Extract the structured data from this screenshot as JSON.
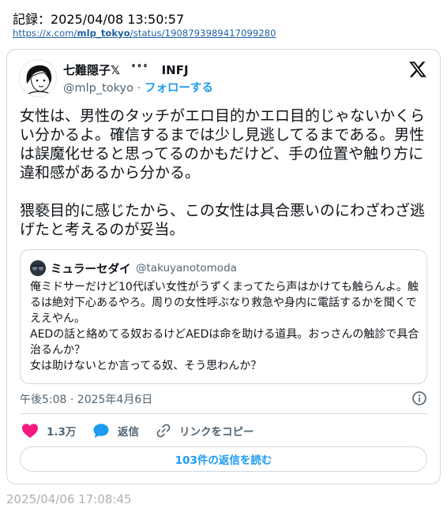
{
  "record": "記録：2025/04/08 13:50:57",
  "url": {
    "prefix": "https://x.com/",
    "user": "mlp_tokyo",
    "suffix": "/status/1908793989417099280"
  },
  "tweet": {
    "display_name": "七難隠子𝕏　ﾟﾟﾟ　INFJ",
    "handle": "@mlp_tokyo",
    "separator": "·",
    "follow_label": "フォローする",
    "text": "女性は、男性のタッチがエロ目的かエロ目的じゃないかくらい分かるよ。確信するまでは少し見逃してるまである。男性は誤魔化せると思ってるのかもだけど、手の位置や触り方に違和感があるから分かる。\n\n猥褻目的に感じたから、この女性は具合悪いのにわざわざ逃げたと考えるのが妥当。",
    "timestamp": "午後5:08 · 2025年4月6日",
    "likes": "1.3万",
    "reply_label": "返信",
    "copy_link_label": "リンクをコピー",
    "read_replies_label": "103件の返信を読む"
  },
  "quote": {
    "display_name": "ミュラーセダイ",
    "handle": "@takuyanotomoda",
    "text": "俺ミドサーだけど10代ぽい女性がうずくまってたら声はかけても触らんよ。触るは絶対下心あるやろ。周りの女性呼ぶなり救急や身内に電話するかを聞くでええやん。\nAEDの話と絡めてる奴おるけどAEDは命を助ける道具。おっさんの触診で具合治るんか？\n女は助けないとか言ってる奴、そう思わんか？"
  },
  "footer_date": "2025/04/06 17:08:45",
  "icons": {
    "x_logo": "x-logo-icon",
    "info": "info-icon",
    "like": "heart-icon",
    "reply": "speech-bubble-icon",
    "copy": "link-icon"
  },
  "colors": {
    "accent": "#1d9bf0",
    "like": "#f91880",
    "secondary_text": "#536471",
    "border": "#cfd9de"
  }
}
